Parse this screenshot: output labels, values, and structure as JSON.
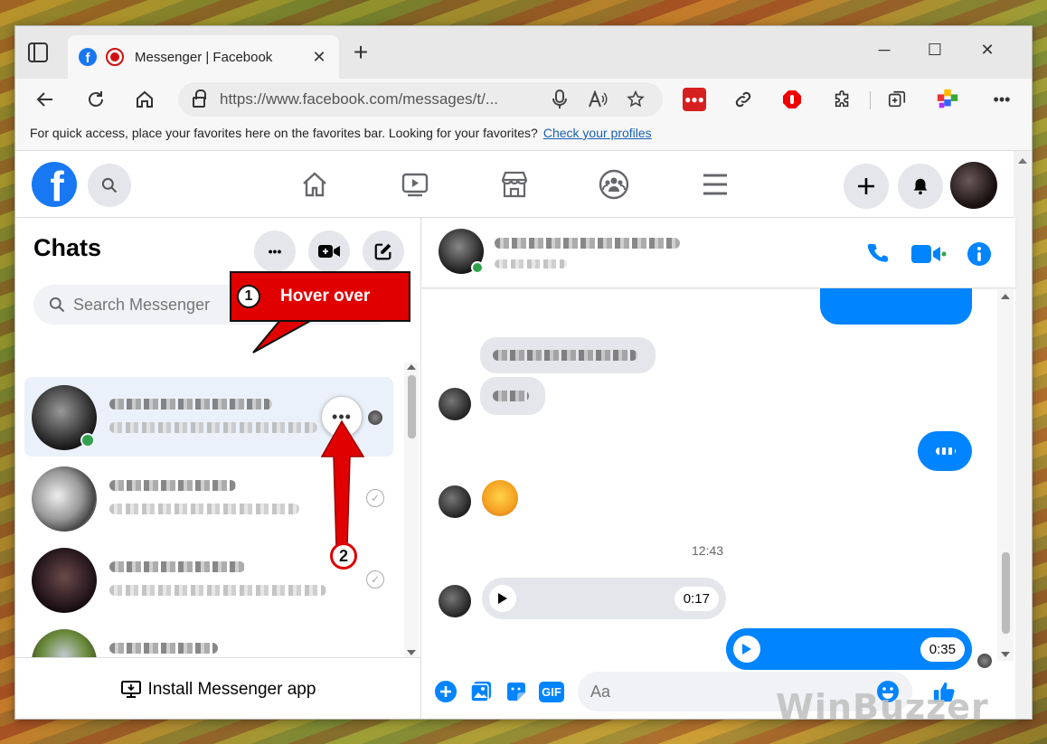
{
  "browser": {
    "tab_title": "Messenger | Facebook",
    "tab_close": "✕",
    "new_tab": "+",
    "minimize": "─",
    "maximize": "☐",
    "close": "✕",
    "url": "https://www.facebook.com/messages/t/...",
    "favorites_text": "For quick access, place your favorites here on the favorites bar. Looking for your favorites?",
    "favorites_link": "Check your profiles"
  },
  "facebook": {
    "logo_letter": "f"
  },
  "chats": {
    "title": "Chats",
    "search_placeholder": "Search Messenger",
    "more_dots": "•••",
    "install_label": "Install Messenger app"
  },
  "conversation": {
    "timestamp": "12:43",
    "audio_received_duration": "0:17",
    "audio_sent_duration": "0:35",
    "input_placeholder": "Aa",
    "gif_label": "GIF"
  },
  "annotations": {
    "step1_number": "1",
    "step1_text": "Hover over",
    "step2_number": "2",
    "accent": "#e00000"
  },
  "watermark": "WinBuzzer",
  "colors": {
    "fb_blue": "#1877f2",
    "messenger_blue": "#0084ff",
    "grey_bubble": "#e4e6eb"
  }
}
